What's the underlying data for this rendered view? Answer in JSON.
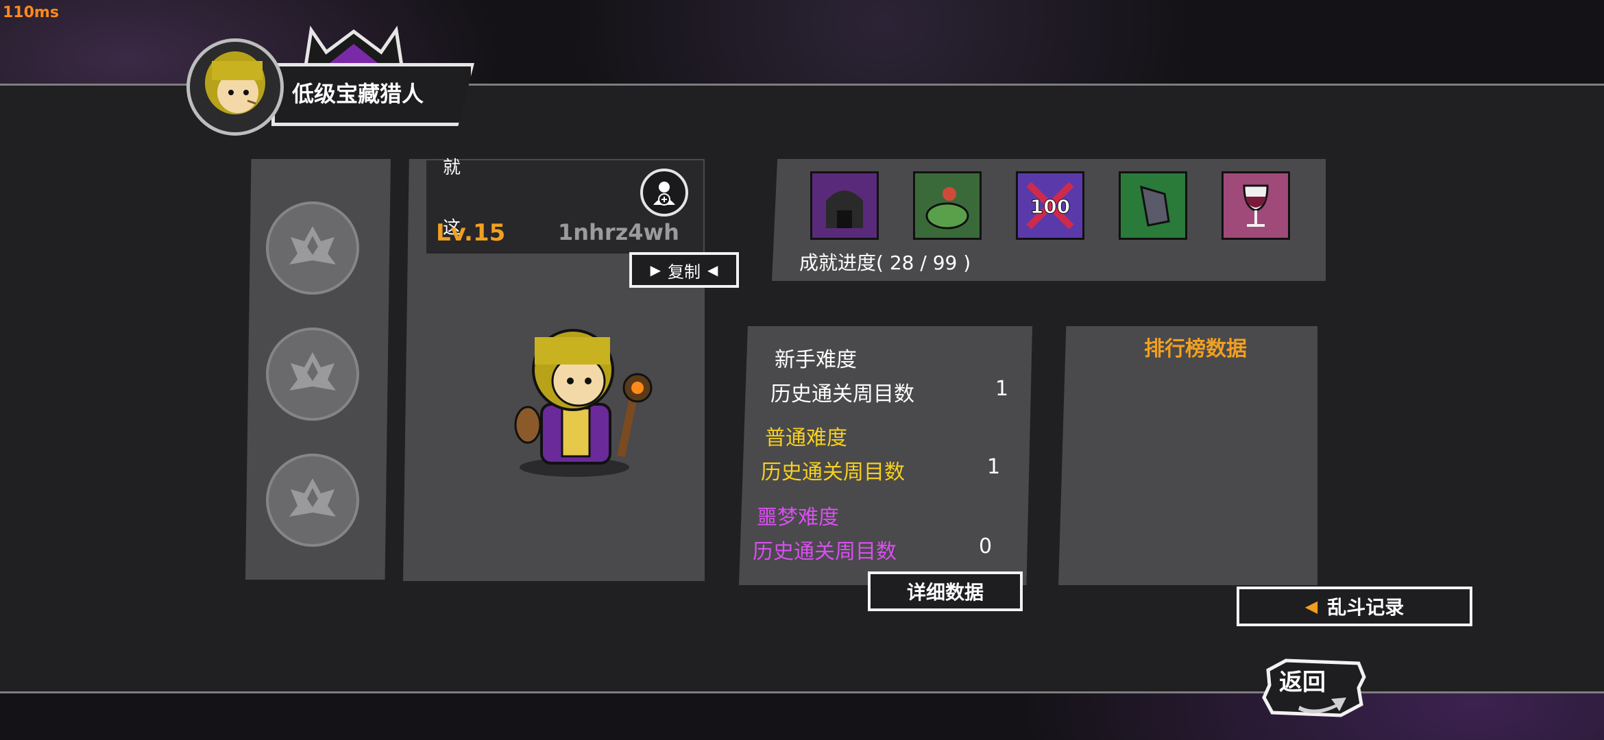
{
  "hud": {
    "ping": "110ms"
  },
  "header": {
    "title": "低级宝藏猎人"
  },
  "profile": {
    "name_chars": [
      "就",
      "这"
    ],
    "level": "Lv.15",
    "uid": "1nhrz4wh",
    "copy_label": "复制"
  },
  "achievements": {
    "icons": [
      "dungeon-gate-icon",
      "frog-rider-icon",
      "hundred-crossed-icon",
      "green-creature-icon",
      "wine-glass-icon"
    ],
    "progress_label": "成就进度( 28 / 99 )"
  },
  "stats": {
    "novice": {
      "label": "新手难度",
      "row_label": "历史通关周目数",
      "value": "1",
      "color": "#ffffff"
    },
    "normal": {
      "label": "普通难度",
      "row_label": "历史通关周目数",
      "value": "1",
      "color": "#f5d020"
    },
    "nightmare": {
      "label": "噩梦难度",
      "row_label": "历史通关周目数",
      "value": "0",
      "color": "#d84ff0"
    },
    "details_label": "详细数据"
  },
  "leaderboard": {
    "title": "排行榜数据"
  },
  "actions": {
    "brawl_label": "乱斗记录",
    "back_label": "返回"
  }
}
